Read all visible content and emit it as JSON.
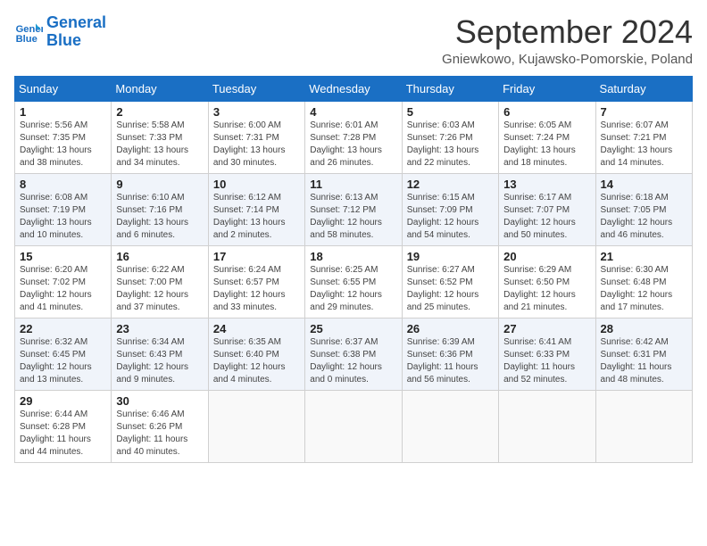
{
  "header": {
    "logo_line1": "General",
    "logo_line2": "Blue",
    "month_title": "September 2024",
    "subtitle": "Gniewkowo, Kujawsko-Pomorskie, Poland"
  },
  "weekdays": [
    "Sunday",
    "Monday",
    "Tuesday",
    "Wednesday",
    "Thursday",
    "Friday",
    "Saturday"
  ],
  "weeks": [
    [
      {
        "day": "1",
        "lines": [
          "Sunrise: 5:56 AM",
          "Sunset: 7:35 PM",
          "Daylight: 13 hours",
          "and 38 minutes."
        ]
      },
      {
        "day": "2",
        "lines": [
          "Sunrise: 5:58 AM",
          "Sunset: 7:33 PM",
          "Daylight: 13 hours",
          "and 34 minutes."
        ]
      },
      {
        "day": "3",
        "lines": [
          "Sunrise: 6:00 AM",
          "Sunset: 7:31 PM",
          "Daylight: 13 hours",
          "and 30 minutes."
        ]
      },
      {
        "day": "4",
        "lines": [
          "Sunrise: 6:01 AM",
          "Sunset: 7:28 PM",
          "Daylight: 13 hours",
          "and 26 minutes."
        ]
      },
      {
        "day": "5",
        "lines": [
          "Sunrise: 6:03 AM",
          "Sunset: 7:26 PM",
          "Daylight: 13 hours",
          "and 22 minutes."
        ]
      },
      {
        "day": "6",
        "lines": [
          "Sunrise: 6:05 AM",
          "Sunset: 7:24 PM",
          "Daylight: 13 hours",
          "and 18 minutes."
        ]
      },
      {
        "day": "7",
        "lines": [
          "Sunrise: 6:07 AM",
          "Sunset: 7:21 PM",
          "Daylight: 13 hours",
          "and 14 minutes."
        ]
      }
    ],
    [
      {
        "day": "8",
        "lines": [
          "Sunrise: 6:08 AM",
          "Sunset: 7:19 PM",
          "Daylight: 13 hours",
          "and 10 minutes."
        ]
      },
      {
        "day": "9",
        "lines": [
          "Sunrise: 6:10 AM",
          "Sunset: 7:16 PM",
          "Daylight: 13 hours",
          "and 6 minutes."
        ]
      },
      {
        "day": "10",
        "lines": [
          "Sunrise: 6:12 AM",
          "Sunset: 7:14 PM",
          "Daylight: 13 hours",
          "and 2 minutes."
        ]
      },
      {
        "day": "11",
        "lines": [
          "Sunrise: 6:13 AM",
          "Sunset: 7:12 PM",
          "Daylight: 12 hours",
          "and 58 minutes."
        ]
      },
      {
        "day": "12",
        "lines": [
          "Sunrise: 6:15 AM",
          "Sunset: 7:09 PM",
          "Daylight: 12 hours",
          "and 54 minutes."
        ]
      },
      {
        "day": "13",
        "lines": [
          "Sunrise: 6:17 AM",
          "Sunset: 7:07 PM",
          "Daylight: 12 hours",
          "and 50 minutes."
        ]
      },
      {
        "day": "14",
        "lines": [
          "Sunrise: 6:18 AM",
          "Sunset: 7:05 PM",
          "Daylight: 12 hours",
          "and 46 minutes."
        ]
      }
    ],
    [
      {
        "day": "15",
        "lines": [
          "Sunrise: 6:20 AM",
          "Sunset: 7:02 PM",
          "Daylight: 12 hours",
          "and 41 minutes."
        ]
      },
      {
        "day": "16",
        "lines": [
          "Sunrise: 6:22 AM",
          "Sunset: 7:00 PM",
          "Daylight: 12 hours",
          "and 37 minutes."
        ]
      },
      {
        "day": "17",
        "lines": [
          "Sunrise: 6:24 AM",
          "Sunset: 6:57 PM",
          "Daylight: 12 hours",
          "and 33 minutes."
        ]
      },
      {
        "day": "18",
        "lines": [
          "Sunrise: 6:25 AM",
          "Sunset: 6:55 PM",
          "Daylight: 12 hours",
          "and 29 minutes."
        ]
      },
      {
        "day": "19",
        "lines": [
          "Sunrise: 6:27 AM",
          "Sunset: 6:52 PM",
          "Daylight: 12 hours",
          "and 25 minutes."
        ]
      },
      {
        "day": "20",
        "lines": [
          "Sunrise: 6:29 AM",
          "Sunset: 6:50 PM",
          "Daylight: 12 hours",
          "and 21 minutes."
        ]
      },
      {
        "day": "21",
        "lines": [
          "Sunrise: 6:30 AM",
          "Sunset: 6:48 PM",
          "Daylight: 12 hours",
          "and 17 minutes."
        ]
      }
    ],
    [
      {
        "day": "22",
        "lines": [
          "Sunrise: 6:32 AM",
          "Sunset: 6:45 PM",
          "Daylight: 12 hours",
          "and 13 minutes."
        ]
      },
      {
        "day": "23",
        "lines": [
          "Sunrise: 6:34 AM",
          "Sunset: 6:43 PM",
          "Daylight: 12 hours",
          "and 9 minutes."
        ]
      },
      {
        "day": "24",
        "lines": [
          "Sunrise: 6:35 AM",
          "Sunset: 6:40 PM",
          "Daylight: 12 hours",
          "and 4 minutes."
        ]
      },
      {
        "day": "25",
        "lines": [
          "Sunrise: 6:37 AM",
          "Sunset: 6:38 PM",
          "Daylight: 12 hours",
          "and 0 minutes."
        ]
      },
      {
        "day": "26",
        "lines": [
          "Sunrise: 6:39 AM",
          "Sunset: 6:36 PM",
          "Daylight: 11 hours",
          "and 56 minutes."
        ]
      },
      {
        "day": "27",
        "lines": [
          "Sunrise: 6:41 AM",
          "Sunset: 6:33 PM",
          "Daylight: 11 hours",
          "and 52 minutes."
        ]
      },
      {
        "day": "28",
        "lines": [
          "Sunrise: 6:42 AM",
          "Sunset: 6:31 PM",
          "Daylight: 11 hours",
          "and 48 minutes."
        ]
      }
    ],
    [
      {
        "day": "29",
        "lines": [
          "Sunrise: 6:44 AM",
          "Sunset: 6:28 PM",
          "Daylight: 11 hours",
          "and 44 minutes."
        ]
      },
      {
        "day": "30",
        "lines": [
          "Sunrise: 6:46 AM",
          "Sunset: 6:26 PM",
          "Daylight: 11 hours",
          "and 40 minutes."
        ]
      },
      {
        "day": "",
        "lines": []
      },
      {
        "day": "",
        "lines": []
      },
      {
        "day": "",
        "lines": []
      },
      {
        "day": "",
        "lines": []
      },
      {
        "day": "",
        "lines": []
      }
    ]
  ]
}
